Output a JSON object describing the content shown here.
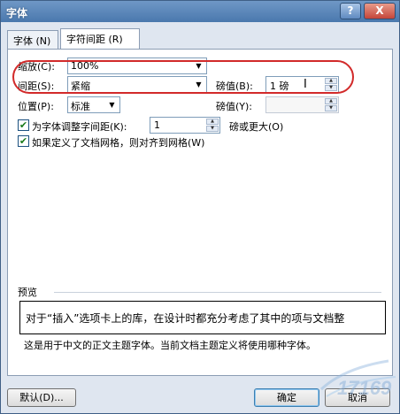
{
  "window": {
    "title": "字体",
    "help_glyph": "?",
    "close_glyph": "X"
  },
  "tabs": [
    {
      "label": "字体 (N)"
    },
    {
      "label": "字符间距 (R)"
    }
  ],
  "spacing": {
    "scale_label": "缩放(C):",
    "scale_value": "100%",
    "spacing_label": "间距(S):",
    "spacing_value": "紧缩",
    "spacing_by_label": "磅值(B):",
    "spacing_by_value": "1 磅",
    "position_label": "位置(P):",
    "position_value": "标准",
    "position_by_label": "磅值(Y):",
    "position_by_value": ""
  },
  "kerning": {
    "label": "为字体调整字间距(K):",
    "value": "1",
    "suffix": "磅或更大(O)",
    "checked": true
  },
  "grid": {
    "label": "如果定义了文档网格，则对齐到网格(W)",
    "checked": true
  },
  "preview": {
    "heading": "预览",
    "sample_text": "对于“插入”选项卡上的库，在设计时都充分考虑了其中的项与文档整",
    "note": "这是用于中文的正文主题字体。当前文档主题定义将使用哪种字体。"
  },
  "buttons": {
    "default": "默认(D)...",
    "ok": "确定",
    "cancel": "取消"
  },
  "colors": {
    "highlight_oval": "#d22a2a",
    "titlebar": "#4a78ad"
  }
}
